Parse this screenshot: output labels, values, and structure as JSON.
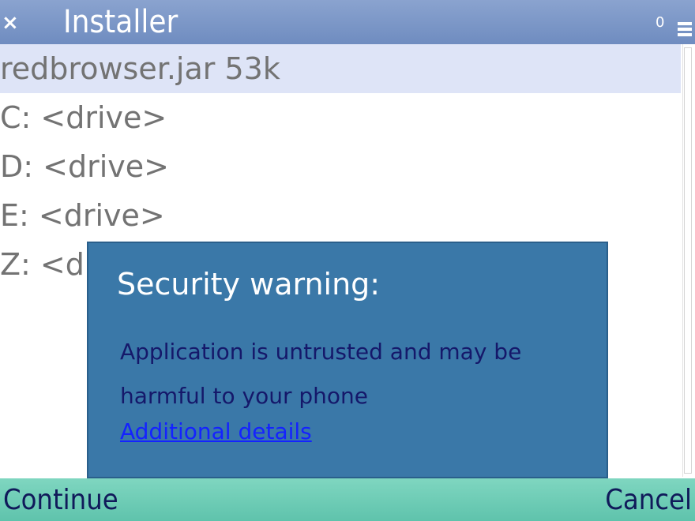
{
  "titlebar": {
    "close_icon": "close-icon",
    "title": "Installer",
    "signal_indicator": "0",
    "menu_icon": "menu-icon"
  },
  "list": {
    "items": [
      {
        "label": "redbrowser.jar 53k",
        "selected": true
      },
      {
        "label": "C: <drive>",
        "selected": false
      },
      {
        "label": "D: <drive>",
        "selected": false
      },
      {
        "label": "E: <drive>",
        "selected": false
      },
      {
        "label": "Z: <drive>",
        "selected": false
      }
    ]
  },
  "dialog": {
    "title": "Security warning:",
    "message": "Application is untrusted and may be harmful to your phone",
    "link": "Additional details"
  },
  "softkeys": {
    "left": "Continue",
    "right": "Cancel"
  },
  "colors": {
    "titlebar": "#7a96c8",
    "selection": "#dee4f7",
    "dialog_bg": "#3a78a8",
    "dialog_text": "#15186a",
    "link": "#1422ff",
    "softkey_bar": "#6fcdb6"
  }
}
